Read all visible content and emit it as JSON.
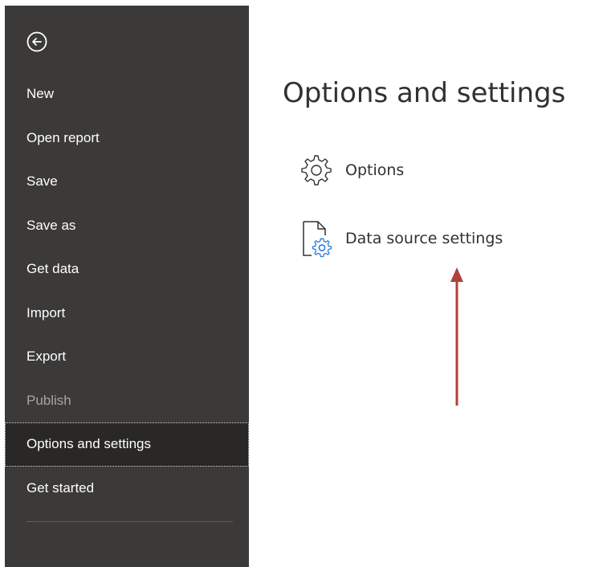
{
  "sidebar": {
    "back_icon": "arrow-left-circle-icon",
    "items": [
      {
        "label": "New",
        "state": "normal"
      },
      {
        "label": "Open report",
        "state": "normal"
      },
      {
        "label": "Save",
        "state": "normal"
      },
      {
        "label": "Save as",
        "state": "normal"
      },
      {
        "label": "Get data",
        "state": "normal"
      },
      {
        "label": "Import",
        "state": "normal"
      },
      {
        "label": "Export",
        "state": "normal"
      },
      {
        "label": "Publish",
        "state": "disabled"
      },
      {
        "label": "Options and settings",
        "state": "selected"
      },
      {
        "label": "Get started",
        "state": "normal"
      }
    ],
    "colors": {
      "background": "#3b3a39",
      "selected_background": "#292827",
      "text": "#ffffff",
      "disabled_text": "#a6a5a3"
    }
  },
  "main": {
    "title": "Options and settings",
    "options": [
      {
        "label": "Options",
        "icon": "gear-icon"
      },
      {
        "label": "Data source settings",
        "icon": "document-gear-icon"
      }
    ],
    "annotation": {
      "icon": "red-arrow-up-icon",
      "color": "#b0413e"
    }
  }
}
